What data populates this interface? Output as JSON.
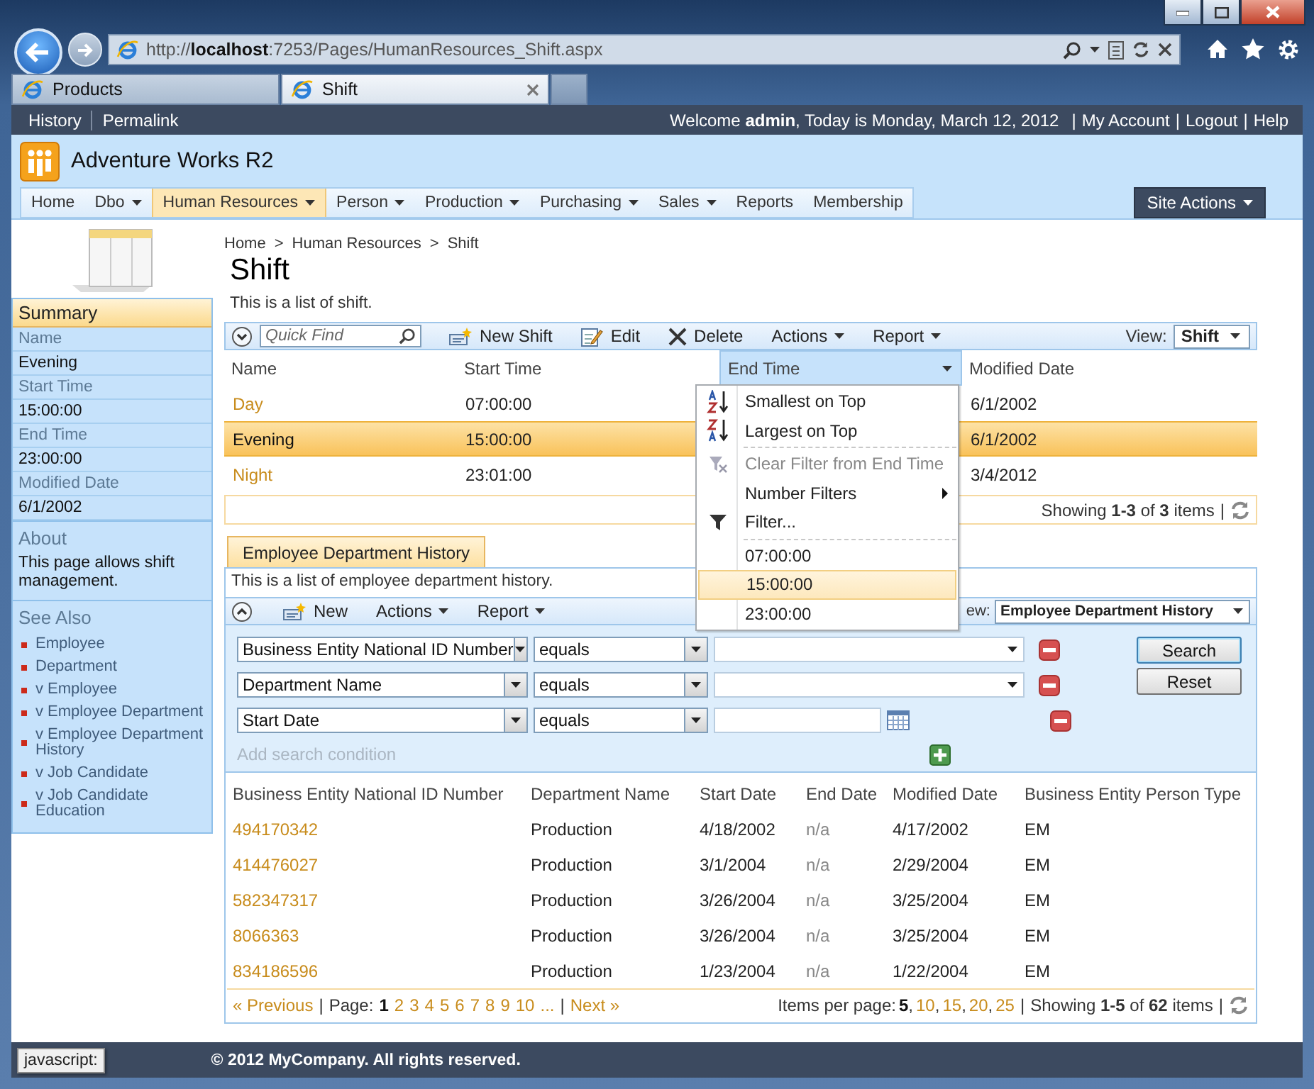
{
  "browser": {
    "address": "http://**localhost**:7253/Pages/HumanResources_Shift.aspx",
    "tabs": [
      {
        "label": "Products",
        "selected": false
      },
      {
        "label": "Shift",
        "selected": true
      }
    ],
    "status": "javascript:"
  },
  "top_bar": {
    "links": [
      "History",
      "Permalink"
    ],
    "welcome": "Welcome **admin**, Today is Monday, March 12, 2012",
    "separator": "|",
    "account_links": [
      "My Account",
      "Logout",
      "Help"
    ]
  },
  "site": {
    "title": "Adventure Works R2"
  },
  "menu": {
    "items": [
      {
        "label": "Home",
        "has_submenu": false,
        "selected": false
      },
      {
        "label": "Dbo",
        "has_submenu": true,
        "selected": false
      },
      {
        "label": "Human Resources",
        "has_submenu": true,
        "selected": true
      },
      {
        "label": "Person",
        "has_submenu": true,
        "selected": false
      },
      {
        "label": "Production",
        "has_submenu": true,
        "selected": false
      },
      {
        "label": "Purchasing",
        "has_submenu": true,
        "selected": false
      },
      {
        "label": "Sales",
        "has_submenu": true,
        "selected": false
      },
      {
        "label": "Reports",
        "has_submenu": false,
        "selected": false
      },
      {
        "label": "Membership",
        "has_submenu": false,
        "selected": false
      }
    ],
    "site_actions": "Site Actions"
  },
  "sidebar": {
    "summary": {
      "title": "Summary",
      "fields": [
        {
          "label": "Name",
          "value": "Evening"
        },
        {
          "label": "Start Time",
          "value": "15:00:00"
        },
        {
          "label": "End Time",
          "value": "23:00:00"
        },
        {
          "label": "Modified Date",
          "value": "6/1/2002"
        }
      ]
    },
    "about": {
      "title": "About",
      "text": "This page allows shift management."
    },
    "see_also": {
      "title": "See Also",
      "links": [
        "Employee",
        "Department",
        "v Employee",
        "v Employee Department",
        "v Employee Department History",
        "v Job Candidate",
        "v Job Candidate Education"
      ]
    }
  },
  "breadcrumb": {
    "items": [
      "Home",
      "Human Resources",
      "Shift"
    ],
    "separator": ">"
  },
  "page_title": "Shift",
  "shift_view": {
    "description": "This is a list of shift.",
    "toolbar": {
      "search_expanded": false,
      "quick_find_placeholder": "Quick Find",
      "buttons": [
        {
          "label": "New Shift",
          "kind": "new"
        },
        {
          "label": "Edit",
          "kind": "edit"
        },
        {
          "label": "Delete",
          "kind": "delete"
        },
        {
          "label": "Actions",
          "kind": "menu"
        },
        {
          "label": "Report",
          "kind": "menu"
        }
      ],
      "view_label": "View:",
      "view": "Shift"
    },
    "columns": [
      {
        "label": "Name",
        "selected": false
      },
      {
        "label": "Start Time",
        "selected": false
      },
      {
        "label": "End Time",
        "selected": true
      },
      {
        "label": "Modified Date",
        "selected": false
      }
    ],
    "rows": [
      {
        "name": "Day",
        "start_time": "07:00:00",
        "modified_date": "6/1/2002",
        "selected": false
      },
      {
        "name": "Evening",
        "start_time": "15:00:00",
        "modified_date": "6/1/2002",
        "selected": true
      },
      {
        "name": "Night",
        "start_time": "23:01:00",
        "modified_date": "3/4/2012",
        "selected": false
      }
    ],
    "status": "Showing **1-3** of **3** items",
    "separator": "|",
    "column_menu": {
      "sort": [
        {
          "label": "Smallest on Top",
          "kind": "sort_ascending"
        },
        {
          "label": "Largest on Top",
          "kind": "sort_descending"
        }
      ],
      "filters": [
        {
          "label": "Clear Filter from End Time",
          "kind": "clear_filter",
          "disabled": true
        },
        {
          "label": "Number Filters",
          "kind": "submenu",
          "disabled": false
        },
        {
          "label": "Filter...",
          "kind": "filter",
          "disabled": false
        }
      ],
      "values": [
        {
          "label": "07:00:00",
          "selected": false
        },
        {
          "label": "15:00:00",
          "selected": true
        },
        {
          "label": "23:00:00",
          "selected": false
        }
      ]
    }
  },
  "history_view": {
    "tab": "Employee Department History",
    "description": "This is a list of employee department history.",
    "toolbar": {
      "search_expanded": true,
      "buttons": [
        {
          "label": "New",
          "kind": "new"
        },
        {
          "label": "Actions",
          "kind": "menu"
        },
        {
          "label": "Report",
          "kind": "menu"
        }
      ],
      "view_label": "ew:",
      "view": "Employee Department History"
    },
    "search": {
      "conditions": [
        {
          "field": "Business Entity National ID Number",
          "operator": "equals",
          "kind": "list"
        },
        {
          "field": "Department Name",
          "operator": "equals",
          "kind": "list"
        },
        {
          "field": "Start Date",
          "operator": "equals",
          "kind": "date"
        }
      ],
      "add_placeholder": "Add search condition",
      "buttons": [
        "Search",
        "Reset"
      ]
    },
    "columns": [
      "Business Entity National ID Number",
      "Department Name",
      "Start Date",
      "End Date",
      "Modified Date",
      "Business Entity Person Type"
    ],
    "rows": [
      [
        "494170342",
        "Production",
        "4/18/2002",
        "n/a",
        "4/17/2002",
        "EM"
      ],
      [
        "414476027",
        "Production",
        "3/1/2004",
        "n/a",
        "2/29/2004",
        "EM"
      ],
      [
        "582347317",
        "Production",
        "3/26/2004",
        "n/a",
        "3/25/2004",
        "EM"
      ],
      [
        "8066363",
        "Production",
        "3/26/2004",
        "n/a",
        "3/25/2004",
        "EM"
      ],
      [
        "834186596",
        "Production",
        "1/23/2004",
        "n/a",
        "1/22/2004",
        "EM"
      ]
    ],
    "pager": {
      "previous": "« Previous",
      "separator": "|",
      "page_label": "Page:",
      "pages": [
        {
          "label": "1",
          "selected": true
        },
        {
          "label": "2",
          "selected": false
        },
        {
          "label": "3",
          "selected": false
        },
        {
          "label": "4",
          "selected": false
        },
        {
          "label": "5",
          "selected": false
        },
        {
          "label": "6",
          "selected": false
        },
        {
          "label": "7",
          "selected": false
        },
        {
          "label": "8",
          "selected": false
        },
        {
          "label": "9",
          "selected": false
        },
        {
          "label": "10",
          "selected": false
        },
        {
          "label": "...",
          "selected": false
        }
      ],
      "next": "Next »",
      "items_per_page_label": "Items per page:",
      "page_size_separator": ",",
      "page_sizes": [
        {
          "label": "5",
          "selected": true
        },
        {
          "label": "10",
          "selected": false
        },
        {
          "label": "15",
          "selected": false
        },
        {
          "label": "20",
          "selected": false
        },
        {
          "label": "25",
          "selected": false
        }
      ],
      "status": "Showing **1-5** of **62** items"
    }
  },
  "footer": {
    "copyright": "© 2012 MyCompany. All rights reserved."
  }
}
